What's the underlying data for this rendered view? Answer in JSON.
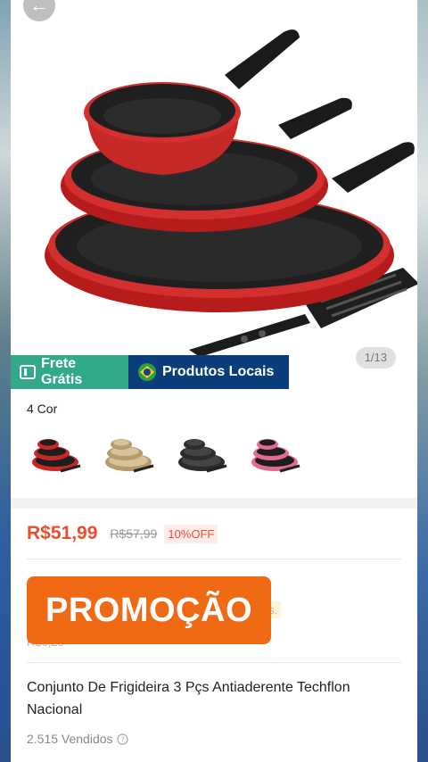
{
  "nav": {
    "back_icon": "arrow-left-icon"
  },
  "gallery": {
    "counter": "1/13"
  },
  "badges": {
    "free_shipping": "Frete Grátis",
    "local_products": "Produtos Locais",
    "flag_icon": "brazil-flag-icon"
  },
  "variants": {
    "label": "4 Cor",
    "items": [
      {
        "color": "#c62828",
        "name": "red"
      },
      {
        "color": "#b59a6a",
        "name": "gold"
      },
      {
        "color": "#2b2b2b",
        "name": "black"
      },
      {
        "color": "#e06a93",
        "name": "pink"
      }
    ]
  },
  "price": {
    "current": "R$51,99",
    "original": "R$57,99",
    "discount": "10%OFF"
  },
  "faded_text": {
    "note_suffix": "ias.",
    "small_price": "R$6,28"
  },
  "promo_banner": "PROMOÇÃO",
  "product": {
    "title": "Conjunto De Frigideira 3 Pçs Antiaderente Techflon Nacional",
    "sold": "2.515 Vendidos"
  },
  "colors": {
    "accent": "#ee4d2d",
    "promo": "#f06a16",
    "free_shipping_bg": "#33a98c",
    "local_bg": "#0b3d7a"
  }
}
